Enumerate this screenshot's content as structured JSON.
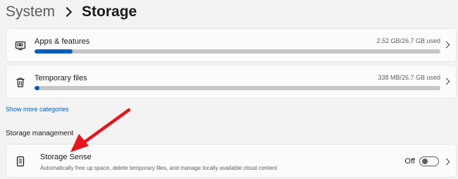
{
  "breadcrumb": {
    "parent": "System",
    "current": "Storage"
  },
  "categories": [
    {
      "title": "Apps & features",
      "size": "2.52 GB/26.7 GB used",
      "usage_fraction": 0.094,
      "icon": "apps-icon"
    },
    {
      "title": "Temporary files",
      "size": "338 MB/26.7 GB used",
      "usage_fraction": 0.012,
      "icon": "trash-icon"
    }
  ],
  "show_more_label": "Show more categories",
  "storage_management": {
    "heading": "Storage management",
    "storage_sense": {
      "title": "Storage Sense",
      "description": "Automatically free up space, delete temporary files, and manage locally available cloud content",
      "toggle_state": "Off",
      "toggle_on": false,
      "icon": "storage-drive-icon"
    }
  },
  "colors": {
    "accent": "#005fb8",
    "bar_track": "#c6c6c6",
    "arrow": "#e8161b",
    "page_bg": "#f3f3f3",
    "card_bg": "#fbfbfb"
  }
}
